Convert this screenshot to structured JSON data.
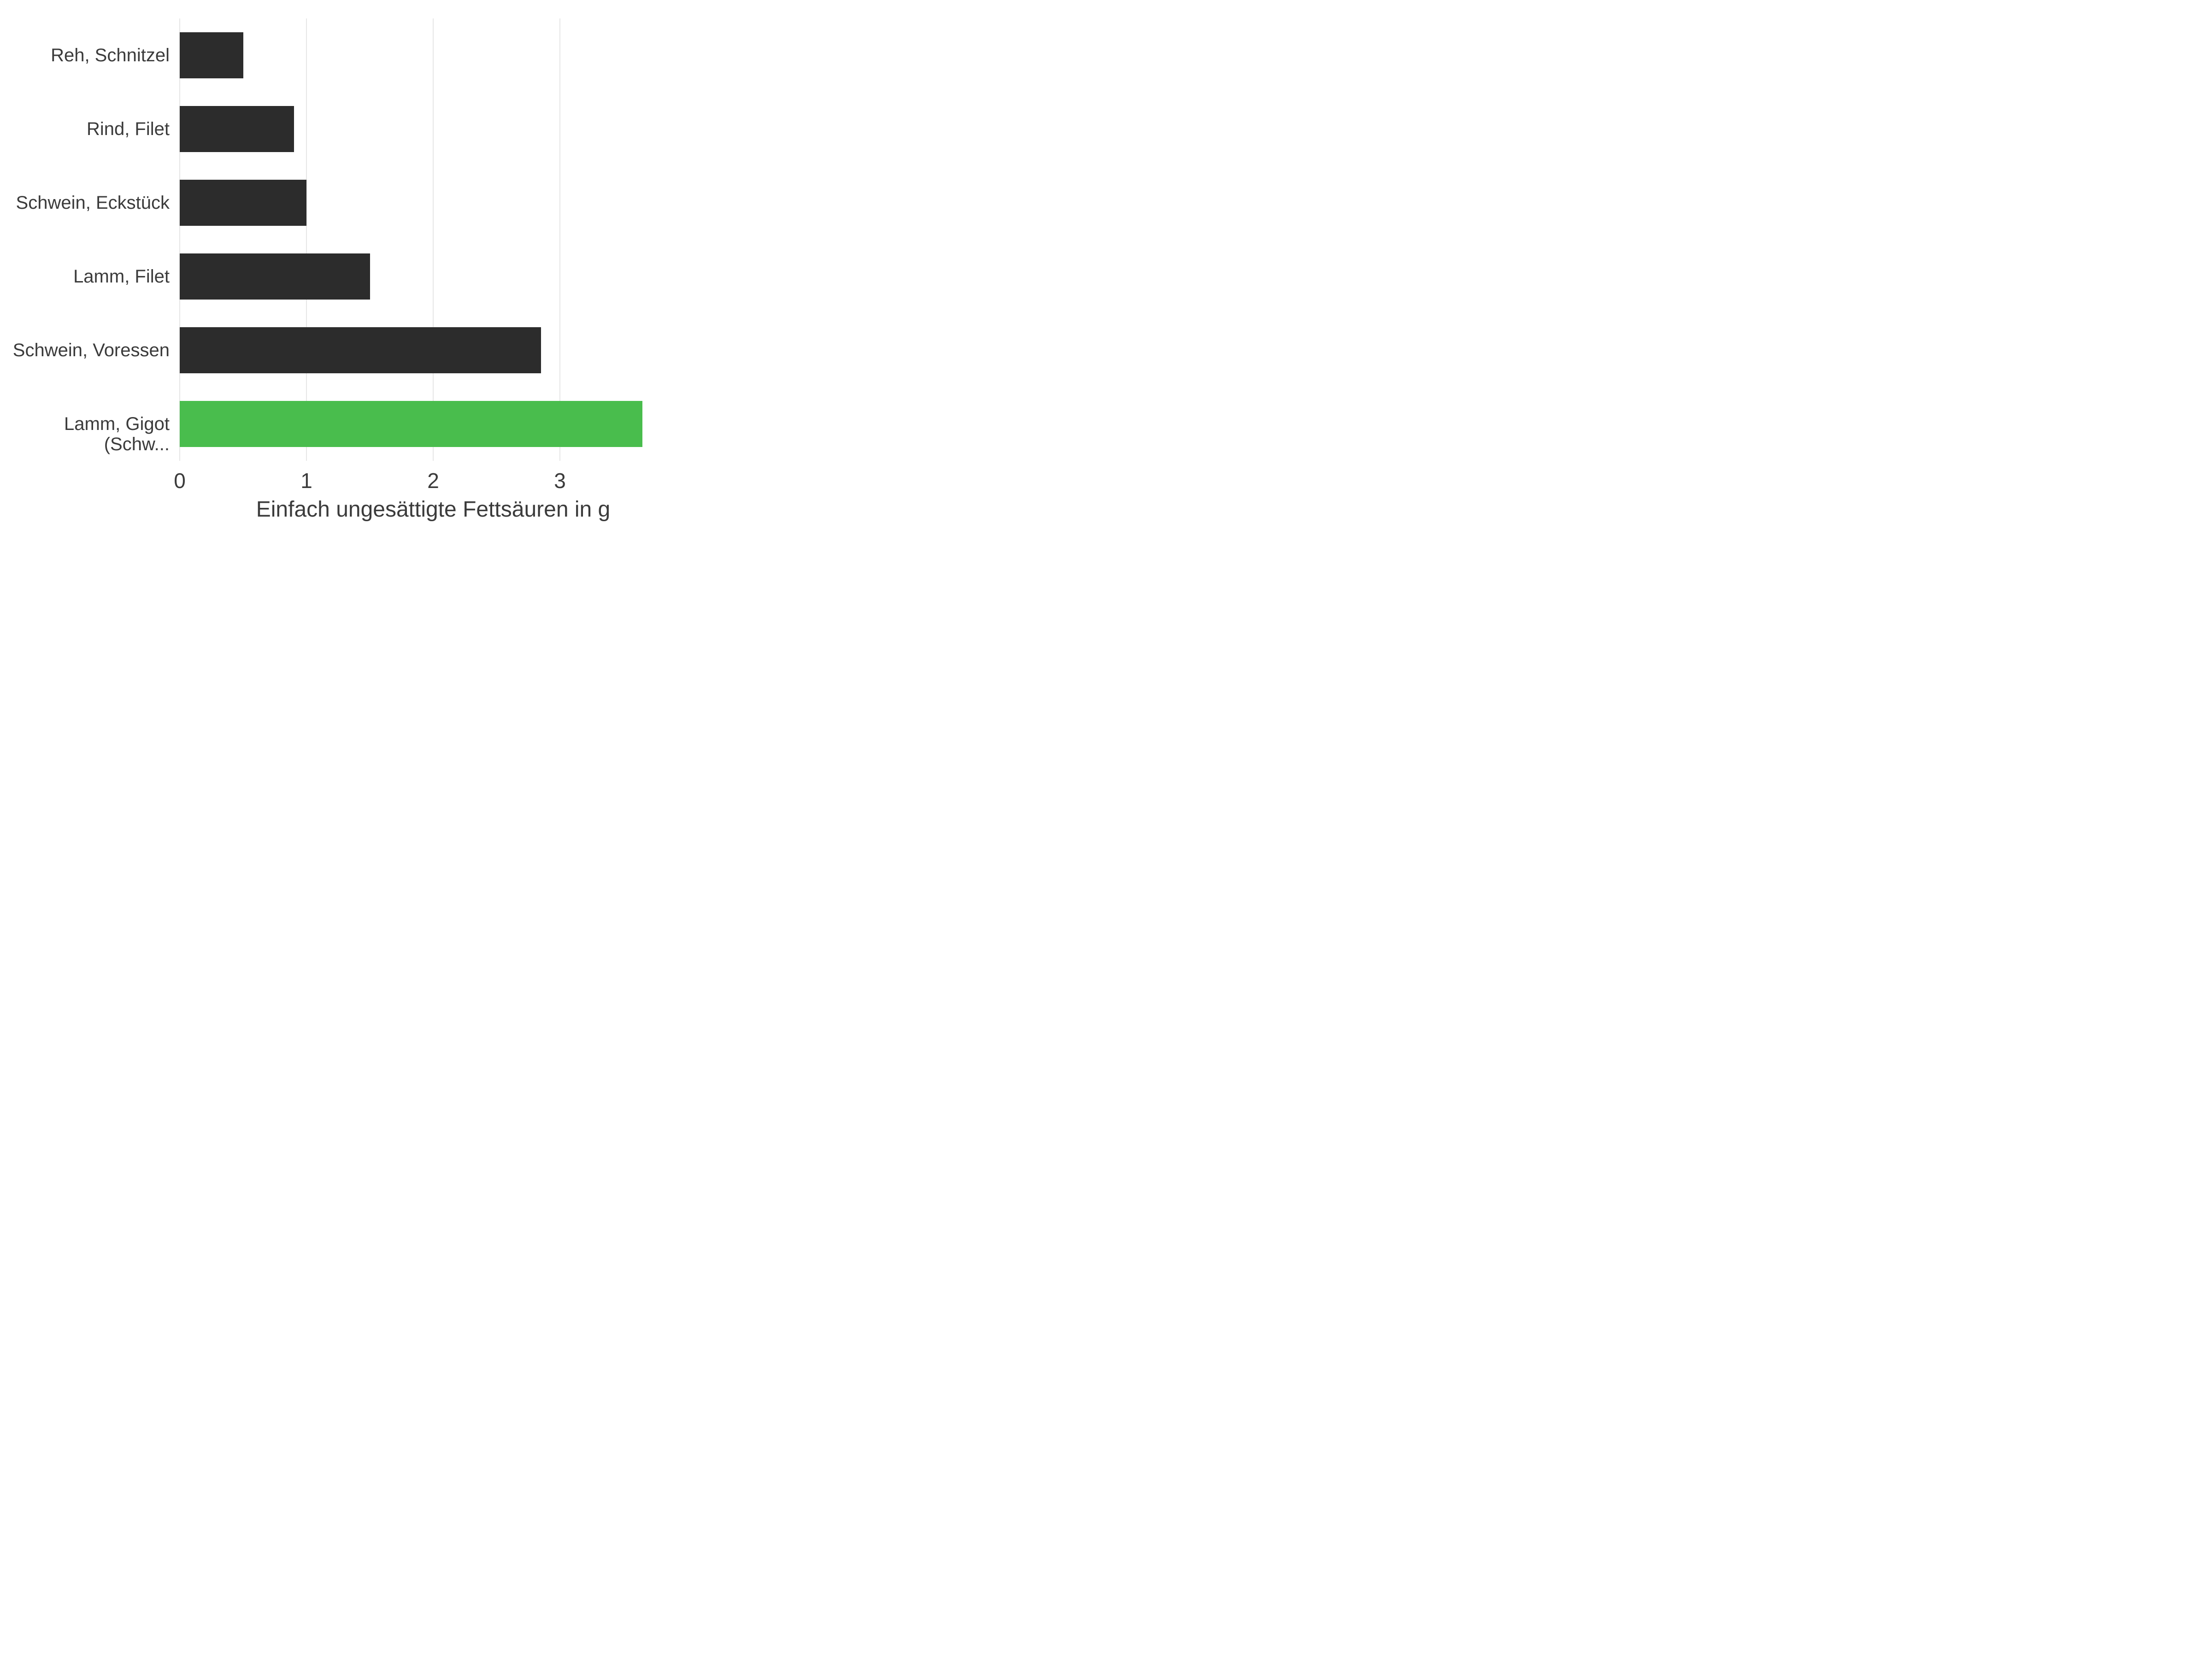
{
  "chart_data": {
    "type": "bar",
    "orientation": "horizontal",
    "categories": [
      "Reh, Schnitzel",
      "Rind, Filet",
      "Schwein, Eckstück",
      "Lamm, Filet",
      "Schwein, Voressen",
      "Lamm, Gigot (Schw..."
    ],
    "values": [
      0.5,
      0.9,
      1.0,
      1.5,
      2.85,
      3.65
    ],
    "highlight_index": 5,
    "xlabel": "Einfach ungesättigte Fettsäuren in g",
    "xlim": [
      0,
      4
    ],
    "xticks": [
      0,
      1,
      2,
      3
    ],
    "colors": {
      "default": "#2c2c2c",
      "highlight": "#49bd4d",
      "grid": "#e6e6e6"
    }
  }
}
